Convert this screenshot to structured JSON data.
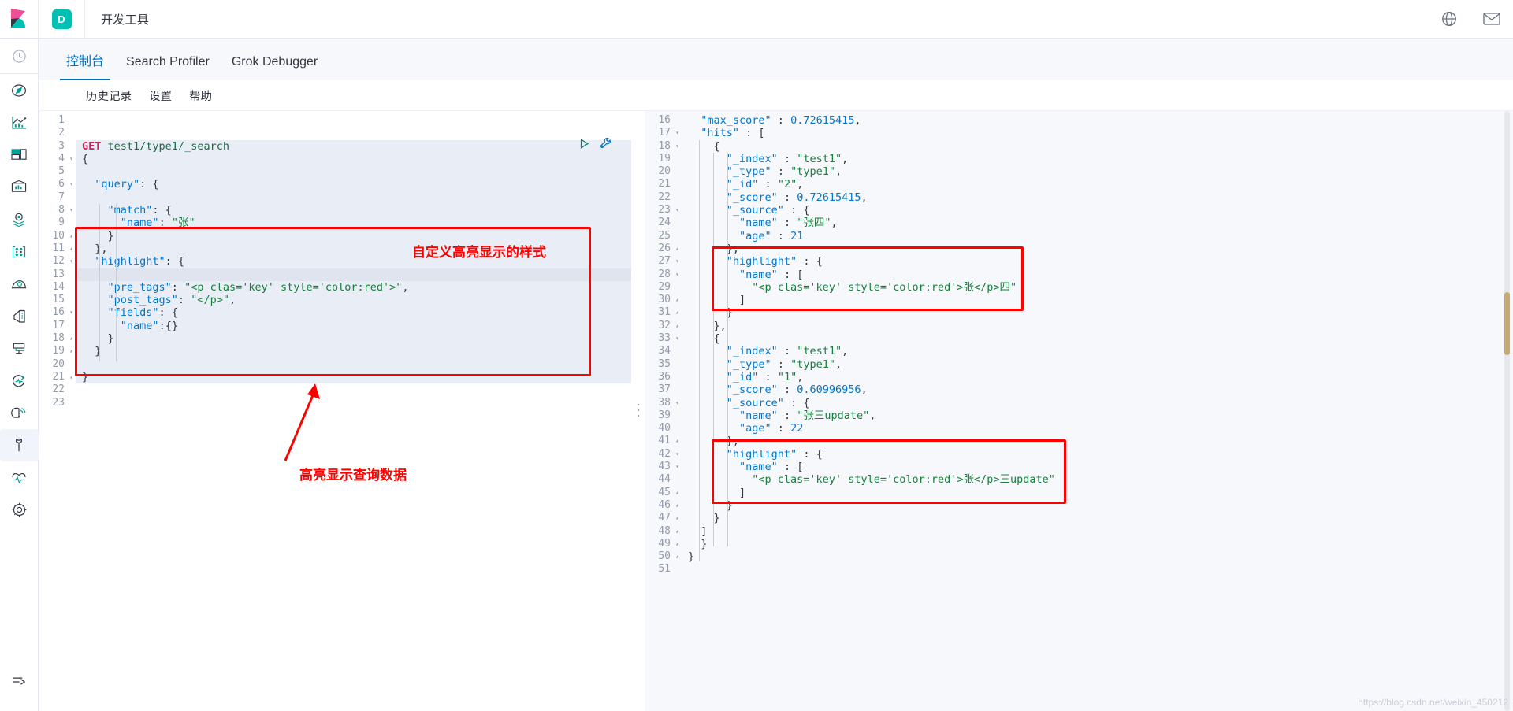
{
  "header": {
    "title": "开发工具",
    "space_badge": "D",
    "logo_icon": "kibana-logo",
    "help_icon": "help-circle-icon",
    "mail_icon": "mail-icon"
  },
  "nav": {
    "items": [
      {
        "name": "recently-viewed",
        "icon": "clock-icon"
      },
      {
        "name": "discover",
        "icon": "compass-icon"
      },
      {
        "name": "visualize",
        "icon": "bar-chart-icon"
      },
      {
        "name": "dashboard",
        "icon": "dashboard-icon"
      },
      {
        "name": "canvas",
        "icon": "canvas-icon"
      },
      {
        "name": "maps",
        "icon": "map-pin-layers-icon"
      },
      {
        "name": "machine-learning",
        "icon": "graph-nodes-icon"
      },
      {
        "name": "infrastructure",
        "icon": "infrastructure-icon"
      },
      {
        "name": "logs",
        "icon": "logs-icon"
      },
      {
        "name": "apm",
        "icon": "apm-icon"
      },
      {
        "name": "uptime",
        "icon": "uptime-icon"
      },
      {
        "name": "siem",
        "icon": "siem-icon"
      },
      {
        "name": "dev-tools",
        "icon": "wrench-icon"
      },
      {
        "name": "monitoring",
        "icon": "heartbeat-icon"
      },
      {
        "name": "management",
        "icon": "gear-icon"
      },
      {
        "name": "collapse",
        "icon": "arrow-right-icon"
      }
    ]
  },
  "tabs": [
    {
      "label": "控制台",
      "selected": true
    },
    {
      "label": "Search Profiler",
      "selected": false
    },
    {
      "label": "Grok Debugger",
      "selected": false
    }
  ],
  "subnav": [
    {
      "label": "历史记录"
    },
    {
      "label": "设置"
    },
    {
      "label": "帮助"
    }
  ],
  "editor": {
    "play_icon": "play-icon",
    "wrench_icon": "wrench-icon",
    "splitter_icon": "vertical-dots-icon",
    "request_lines": [
      {
        "n": 1,
        "fold": "",
        "text": "",
        "req": false
      },
      {
        "n": 2,
        "fold": "",
        "text": "",
        "req": false
      },
      {
        "n": 3,
        "fold": "",
        "text": "GET test1/type1/_search",
        "req": true
      },
      {
        "n": 4,
        "fold": "▾",
        "text": "{",
        "req": true
      },
      {
        "n": 5,
        "fold": "",
        "text": "",
        "req": true
      },
      {
        "n": 6,
        "fold": "▾",
        "text": "  \"query\": {",
        "req": true
      },
      {
        "n": 7,
        "fold": "",
        "text": "",
        "req": true
      },
      {
        "n": 8,
        "fold": "▾",
        "text": "    \"match\": {",
        "req": true
      },
      {
        "n": 9,
        "fold": "",
        "text": "      \"name\": \"张\"",
        "req": true
      },
      {
        "n": 10,
        "fold": "▴",
        "text": "    }",
        "req": true
      },
      {
        "n": 11,
        "fold": "▴",
        "text": "  },",
        "req": true
      },
      {
        "n": 12,
        "fold": "▾",
        "text": "  \"highlight\": {",
        "req": true
      },
      {
        "n": 13,
        "fold": "",
        "text": "",
        "req": true,
        "cursor": true
      },
      {
        "n": 14,
        "fold": "",
        "text": "    \"pre_tags\": \"<p clas='key' style='color:red'>\",",
        "req": true
      },
      {
        "n": 15,
        "fold": "",
        "text": "    \"post_tags\": \"</p>\",",
        "req": true
      },
      {
        "n": 16,
        "fold": "▾",
        "text": "    \"fields\": {",
        "req": true
      },
      {
        "n": 17,
        "fold": "",
        "text": "      \"name\":{}",
        "req": true
      },
      {
        "n": 18,
        "fold": "▴",
        "text": "    }",
        "req": true
      },
      {
        "n": 19,
        "fold": "▴",
        "text": "  }",
        "req": true
      },
      {
        "n": 20,
        "fold": "",
        "text": "",
        "req": true
      },
      {
        "n": 21,
        "fold": "▴",
        "text": "}",
        "req": true
      },
      {
        "n": 22,
        "fold": "",
        "text": "",
        "req": false
      },
      {
        "n": 23,
        "fold": "",
        "text": "",
        "req": false
      }
    ],
    "response_lines": [
      {
        "n": 16,
        "fold": "",
        "text": "  \"max_score\" : 0.72615415,"
      },
      {
        "n": 17,
        "fold": "▾",
        "text": "  \"hits\" : ["
      },
      {
        "n": 18,
        "fold": "▾",
        "text": "    {"
      },
      {
        "n": 19,
        "fold": "",
        "text": "      \"_index\" : \"test1\","
      },
      {
        "n": 20,
        "fold": "",
        "text": "      \"_type\" : \"type1\","
      },
      {
        "n": 21,
        "fold": "",
        "text": "      \"_id\" : \"2\","
      },
      {
        "n": 22,
        "fold": "",
        "text": "      \"_score\" : 0.72615415,"
      },
      {
        "n": 23,
        "fold": "▾",
        "text": "      \"_source\" : {"
      },
      {
        "n": 24,
        "fold": "",
        "text": "        \"name\" : \"张四\","
      },
      {
        "n": 25,
        "fold": "",
        "text": "        \"age\" : 21"
      },
      {
        "n": 26,
        "fold": "▴",
        "text": "      },"
      },
      {
        "n": 27,
        "fold": "▾",
        "text": "      \"highlight\" : {"
      },
      {
        "n": 28,
        "fold": "▾",
        "text": "        \"name\" : ["
      },
      {
        "n": 29,
        "fold": "",
        "text": "          \"<p clas='key' style='color:red'>张</p>四\""
      },
      {
        "n": 30,
        "fold": "▴",
        "text": "        ]"
      },
      {
        "n": 31,
        "fold": "▴",
        "text": "      }"
      },
      {
        "n": 32,
        "fold": "▴",
        "text": "    },"
      },
      {
        "n": 33,
        "fold": "▾",
        "text": "    {"
      },
      {
        "n": 34,
        "fold": "",
        "text": "      \"_index\" : \"test1\","
      },
      {
        "n": 35,
        "fold": "",
        "text": "      \"_type\" : \"type1\","
      },
      {
        "n": 36,
        "fold": "",
        "text": "      \"_id\" : \"1\","
      },
      {
        "n": 37,
        "fold": "",
        "text": "      \"_score\" : 0.60996956,"
      },
      {
        "n": 38,
        "fold": "▾",
        "text": "      \"_source\" : {"
      },
      {
        "n": 39,
        "fold": "",
        "text": "        \"name\" : \"张三update\","
      },
      {
        "n": 40,
        "fold": "",
        "text": "        \"age\" : 22"
      },
      {
        "n": 41,
        "fold": "▴",
        "text": "      },"
      },
      {
        "n": 42,
        "fold": "▾",
        "text": "      \"highlight\" : {"
      },
      {
        "n": 43,
        "fold": "▾",
        "text": "        \"name\" : ["
      },
      {
        "n": 44,
        "fold": "",
        "text": "          \"<p clas='key' style='color:red'>张</p>三update\""
      },
      {
        "n": 45,
        "fold": "▴",
        "text": "        ]"
      },
      {
        "n": 46,
        "fold": "▴",
        "text": "      }"
      },
      {
        "n": 47,
        "fold": "▴",
        "text": "    }"
      },
      {
        "n": 48,
        "fold": "▴",
        "text": "  ]"
      },
      {
        "n": 49,
        "fold": "▴",
        "text": "  }"
      },
      {
        "n": 50,
        "fold": "▴",
        "text": "}"
      },
      {
        "n": 51,
        "fold": "",
        "text": ""
      }
    ]
  },
  "annotations": {
    "label_style": "自定义高亮显示的样式",
    "label_data": "高亮显示查询数据",
    "watermark": "https://blog.csdn.net/weixin_450212"
  }
}
